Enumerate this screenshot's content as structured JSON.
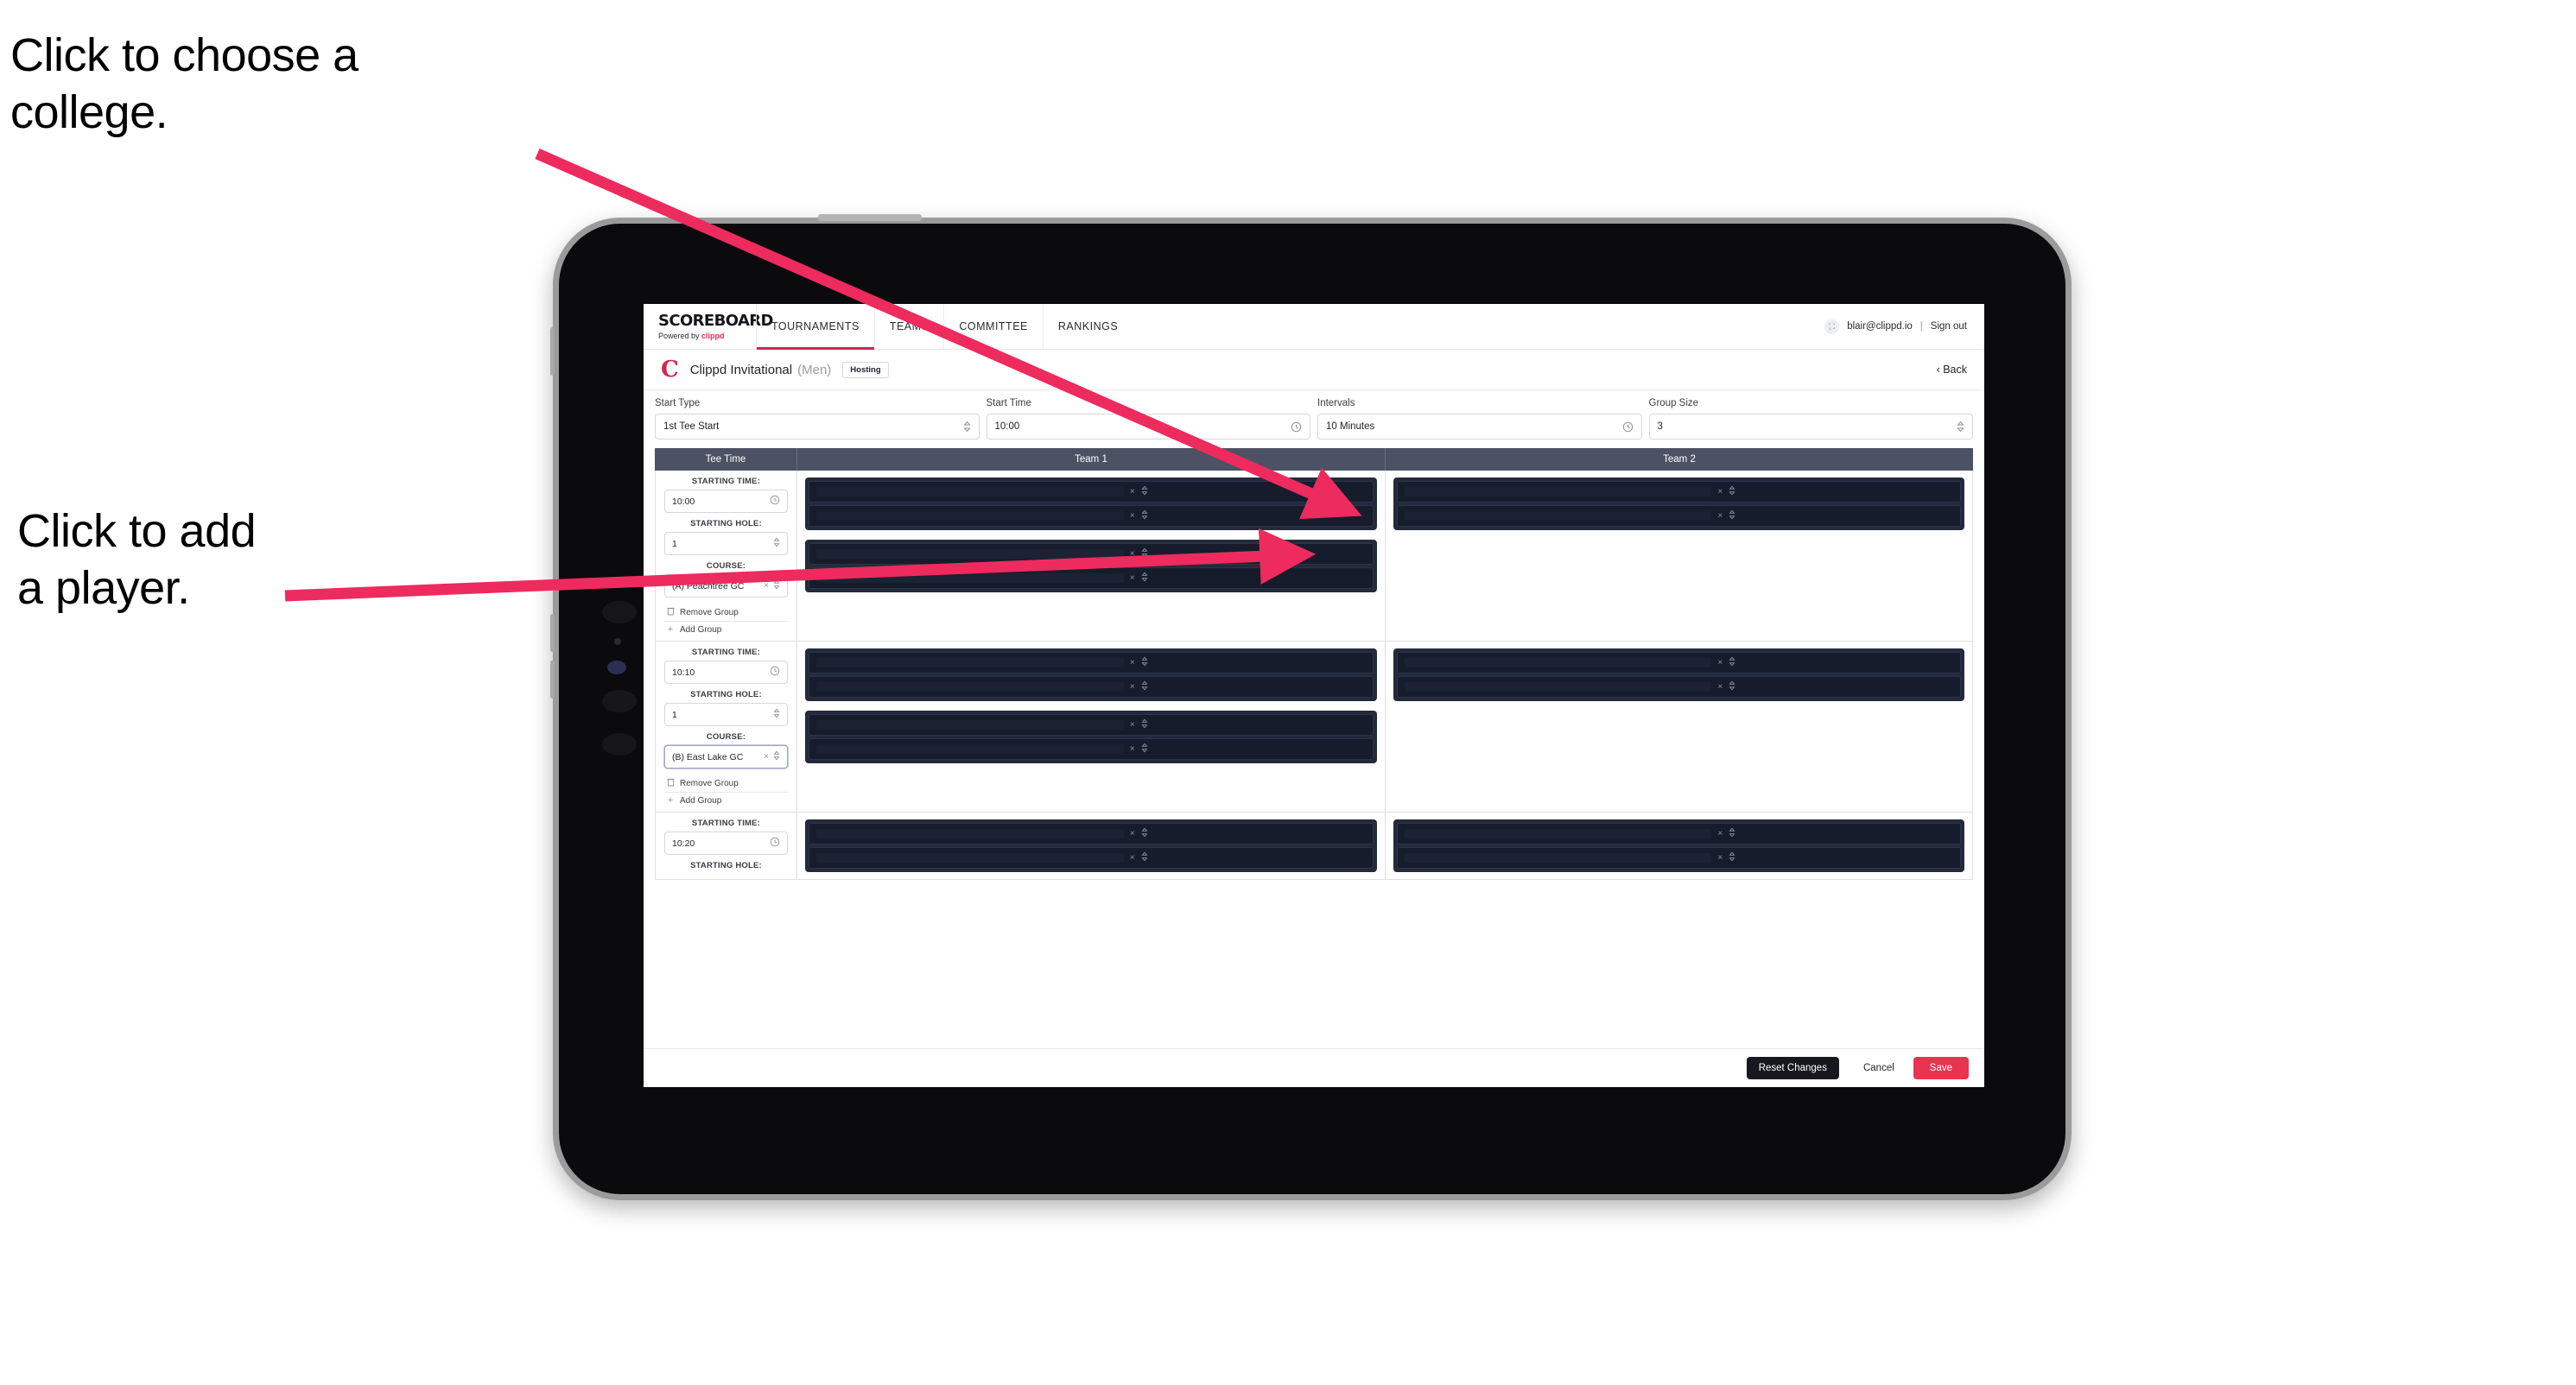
{
  "annotations": {
    "college": "Click to choose a\ncollege.",
    "player": "Click to add\na player."
  },
  "colors": {
    "accent_pink": "#e8344f",
    "arrow_pink": "#ed2b5e",
    "table_header": "#4c5263",
    "player_block": "#232a3b",
    "player_row": "#161c2b",
    "brand_red": "#d9234f"
  },
  "topnav": {
    "brand_title": "SCOREBOARD",
    "brand_sub_prefix": "Powered by ",
    "brand_sub_name": "clippd",
    "items": [
      {
        "label": "TOURNAMENTS",
        "active": true
      },
      {
        "label": "TEAMS",
        "active": false
      },
      {
        "label": "COMMITTEE",
        "active": false
      },
      {
        "label": "RANKINGS",
        "active": false
      }
    ],
    "account": {
      "avatar_glyph": "⛶",
      "email": "blair@clippd.io",
      "separator": "|",
      "sign_out": "Sign out"
    }
  },
  "subheader": {
    "logo_letter": "C",
    "tournament_name": "Clippd Invitational",
    "gender": "(Men)",
    "badge": "Hosting",
    "back_label": "‹  Back"
  },
  "controls": [
    {
      "label": "Start Type",
      "value": "1st Tee Start",
      "icon": "⌃⌄",
      "icon_name": "stepper-icon"
    },
    {
      "label": "Start Time",
      "value": "10:00",
      "icon": "◴",
      "icon_name": "clock-icon"
    },
    {
      "label": "Intervals",
      "value": "10 Minutes",
      "icon": "◴",
      "icon_name": "clock-icon"
    },
    {
      "label": "Group Size",
      "value": "3",
      "icon": "⌃⌄",
      "icon_name": "stepper-icon"
    }
  ],
  "table": {
    "headers": [
      "Tee Time",
      "Team 1",
      "Team 2"
    ],
    "field_labels": {
      "starting_time": "STARTING TIME:",
      "starting_hole": "STARTING HOLE:",
      "course": "COURSE:"
    },
    "group_actions": {
      "remove": "Remove Group",
      "add": "Add Group",
      "remove_icon": "🗑",
      "add_icon": "+"
    },
    "clear_icon": "×",
    "stepper_icon": "⌃⌄",
    "rows": [
      {
        "starting_time": "10:00",
        "starting_hole": "1",
        "course": "(A) Peachtree GC",
        "course_focused": false,
        "team1_blocks": [
          2,
          2
        ],
        "team2_blocks": [
          2
        ]
      },
      {
        "starting_time": "10:10",
        "starting_hole": "1",
        "course": "(B) East Lake GC",
        "course_focused": true,
        "team1_blocks": [
          2,
          2
        ],
        "team2_blocks": [
          2
        ]
      },
      {
        "starting_time": "10:20",
        "starting_hole": "",
        "course": "",
        "course_focused": false,
        "team1_blocks": [
          2
        ],
        "team2_blocks": [
          2
        ]
      }
    ]
  },
  "footer": {
    "reset_label": "Reset Changes",
    "cancel_label": "Cancel",
    "save_label": "Save"
  }
}
